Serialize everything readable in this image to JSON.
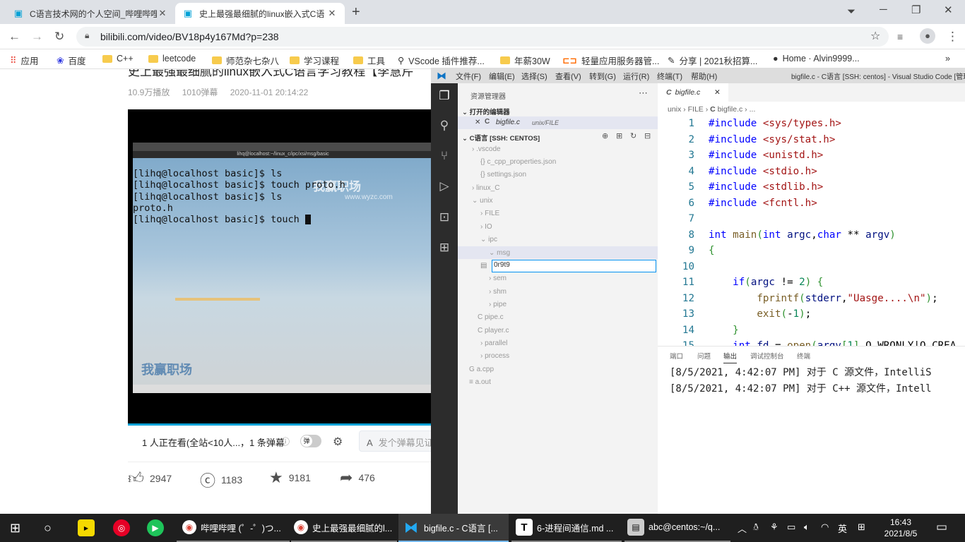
{
  "browser": {
    "tabs": [
      {
        "title": "C语言技术网的个人空间_哔哩哔哩",
        "icon": "bilibili-icon"
      },
      {
        "title": "史上最强最细腻的linux嵌入式C语",
        "icon": "bilibili-icon"
      }
    ],
    "url": "bilibili.com/video/BV18p4y167Md?p=238",
    "bookmarks": [
      "应用",
      "百度",
      "C++",
      "leetcode",
      "师范杂七杂八",
      "学习课程",
      "工具",
      "VScode 插件推荐...",
      "年薪30W",
      "轻量应用服务器管...",
      "分享 | 2021秋招算...",
      "Home · Alvin9999..."
    ]
  },
  "video": {
    "title": "史上最强最细腻的linux嵌入式C语言学习教程【李慧芹",
    "views": "10.9万播放",
    "danmaku_count": "1010弹幕",
    "date": "2020-11-01 20:14:22",
    "terminal_title": "lihq@localhost:~/linux_c/ipc/xsi/msg/basic",
    "terminal_lines": [
      "[lihq@localhost basic]$ ls",
      "[lihq@localhost basic]$ touch proto.h",
      "[lihq@localhost basic]$ ls",
      "proto.h",
      "[lihq@localhost basic]$ touch "
    ],
    "watermark": "www.wyzc.com",
    "watching": "1 人正在看(全站<10人...，1 条弹幕",
    "danmu_toggle": "弹",
    "danmu_placeholder": "发个弹幕见证",
    "likes": "2947",
    "coins": "1183",
    "favorites": "9181",
    "shares": "476"
  },
  "vscode": {
    "menu": [
      "文件(F)",
      "编辑(E)",
      "选择(S)",
      "查看(V)",
      "转到(G)",
      "运行(R)",
      "终端(T)",
      "帮助(H)"
    ],
    "window_title": "bigfile.c - C语言 [SSH: centos] - Visual Studio Code [管理",
    "explorer_title": "资源管理器",
    "open_editors_label": "打开的编辑器",
    "open_file": "bigfile.c",
    "open_file_path": "unix/FILE",
    "workspace_label": "C语言 [SSH: CENTOS]",
    "tree": [
      {
        "name": ".vscode",
        "indent": 1
      },
      {
        "name": "c_cpp_properties.json",
        "indent": 2
      },
      {
        "name": "settings.json",
        "indent": 2
      },
      {
        "name": "linux_C",
        "indent": 1
      },
      {
        "name": "unix",
        "indent": 1
      },
      {
        "name": "FILE",
        "indent": 2
      },
      {
        "name": "IO",
        "indent": 2
      },
      {
        "name": "ipc",
        "indent": 2
      },
      {
        "name": "msg",
        "indent": 3
      },
      {
        "name": "sem",
        "indent": 3
      },
      {
        "name": "shm",
        "indent": 3
      },
      {
        "name": "pipe",
        "indent": 3
      },
      {
        "name": "pipe.c",
        "indent": 2
      },
      {
        "name": "player.c",
        "indent": 2
      },
      {
        "name": "parallel",
        "indent": 2
      },
      {
        "name": "process",
        "indent": 2
      },
      {
        "name": "a.cpp",
        "indent": 1
      },
      {
        "name": "a.out",
        "indent": 1
      }
    ],
    "rename_value": "0r9t9",
    "editor_tab": "bigfile.c",
    "breadcrumb": [
      "unix",
      "FILE",
      "bigfile.c",
      "..."
    ],
    "code_lines": [
      "#include <sys/types.h>",
      "#include <sys/stat.h>",
      "#include <unistd.h>",
      "#include <stdio.h>",
      "#include <stdlib.h>",
      "#include <fcntl.h>",
      "",
      "int main(int argc,char ** argv)",
      "{",
      "",
      "    if(argc != 2) {",
      "        fprintf(stderr,\"Uasge....\\n\");",
      "        exit(-1);",
      "    }",
      "    int fd = open(argv[1],O_WRONLY|O_CREA"
    ],
    "line_numbers": [
      "1",
      "2",
      "3",
      "4",
      "5",
      "6",
      "7",
      "8",
      "9",
      "10",
      "11",
      "12",
      "13",
      "14",
      "15"
    ],
    "panel_tabs": [
      "端口",
      "问题",
      "输出",
      "调试控制台",
      "终端"
    ],
    "output_lines": [
      "[8/5/2021, 4:42:07 PM] 对于 C 源文件，IntelliS",
      "[8/5/2021, 4:42:07 PM] 对于 C++ 源文件，Intell"
    ]
  },
  "taskbar": {
    "items": [
      {
        "label": "哔哩哔哩 (゜-゜)つ...",
        "icon": "chrome-icon"
      },
      {
        "label": "史上最强最细腻的l...",
        "icon": "chrome-icon"
      },
      {
        "label": "bigfile.c - C语言 [...",
        "icon": "vscode-icon"
      },
      {
        "label": "6-进程间通信.md ...",
        "icon": "typora-icon"
      },
      {
        "label": "abc@centos:~/q...",
        "icon": "terminal-icon"
      }
    ],
    "ime": "英",
    "time": "16:43",
    "date": "2021/8/5"
  }
}
